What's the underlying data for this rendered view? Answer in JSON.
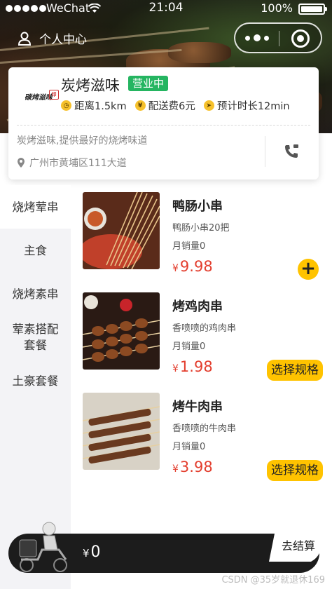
{
  "status_bar": {
    "carrier": "WeChat",
    "time": "21:04",
    "battery": "100%"
  },
  "header": {
    "profile_label": "个人中心"
  },
  "shop": {
    "logo_text": "碳烤滋味",
    "name": "炭烤滋味",
    "status": "营业中",
    "distance": "距离1.5km",
    "delivery_fee": "配送费6元",
    "eta": "预计时长12min",
    "slogan": "炭烤滋味,提供最好的烧烤味道",
    "address": "广州市黄埔区111大道"
  },
  "categories": [
    {
      "label": "烧烤荤串",
      "active": true
    },
    {
      "label": "主食",
      "active": false
    },
    {
      "label": "烧烤素串",
      "active": false
    },
    {
      "label": "荤素搭配套餐",
      "active": false
    },
    {
      "label": "土豪套餐",
      "active": false
    }
  ],
  "goods": [
    {
      "name": "鸭肠小串",
      "desc": "鸭肠小串20把",
      "sales": "月销量0",
      "currency": "¥",
      "price": "9.98",
      "action": "+"
    },
    {
      "name": "烤鸡肉串",
      "desc": "香喷喷的鸡肉串",
      "sales": "月销量0",
      "currency": "¥",
      "price": "1.98",
      "action": "选择规格"
    },
    {
      "name": "烤牛肉串",
      "desc": "香喷喷的牛肉串",
      "sales": "月销量0",
      "currency": "¥",
      "price": "3.98",
      "action": "选择规格"
    }
  ],
  "cart": {
    "currency": "¥",
    "total": "0",
    "checkout_label": "去结算"
  },
  "watermark": "CSDN @35岁就退休169",
  "colors": {
    "accent": "#ffc300",
    "price": "#e33e2e",
    "open": "#25b561"
  }
}
